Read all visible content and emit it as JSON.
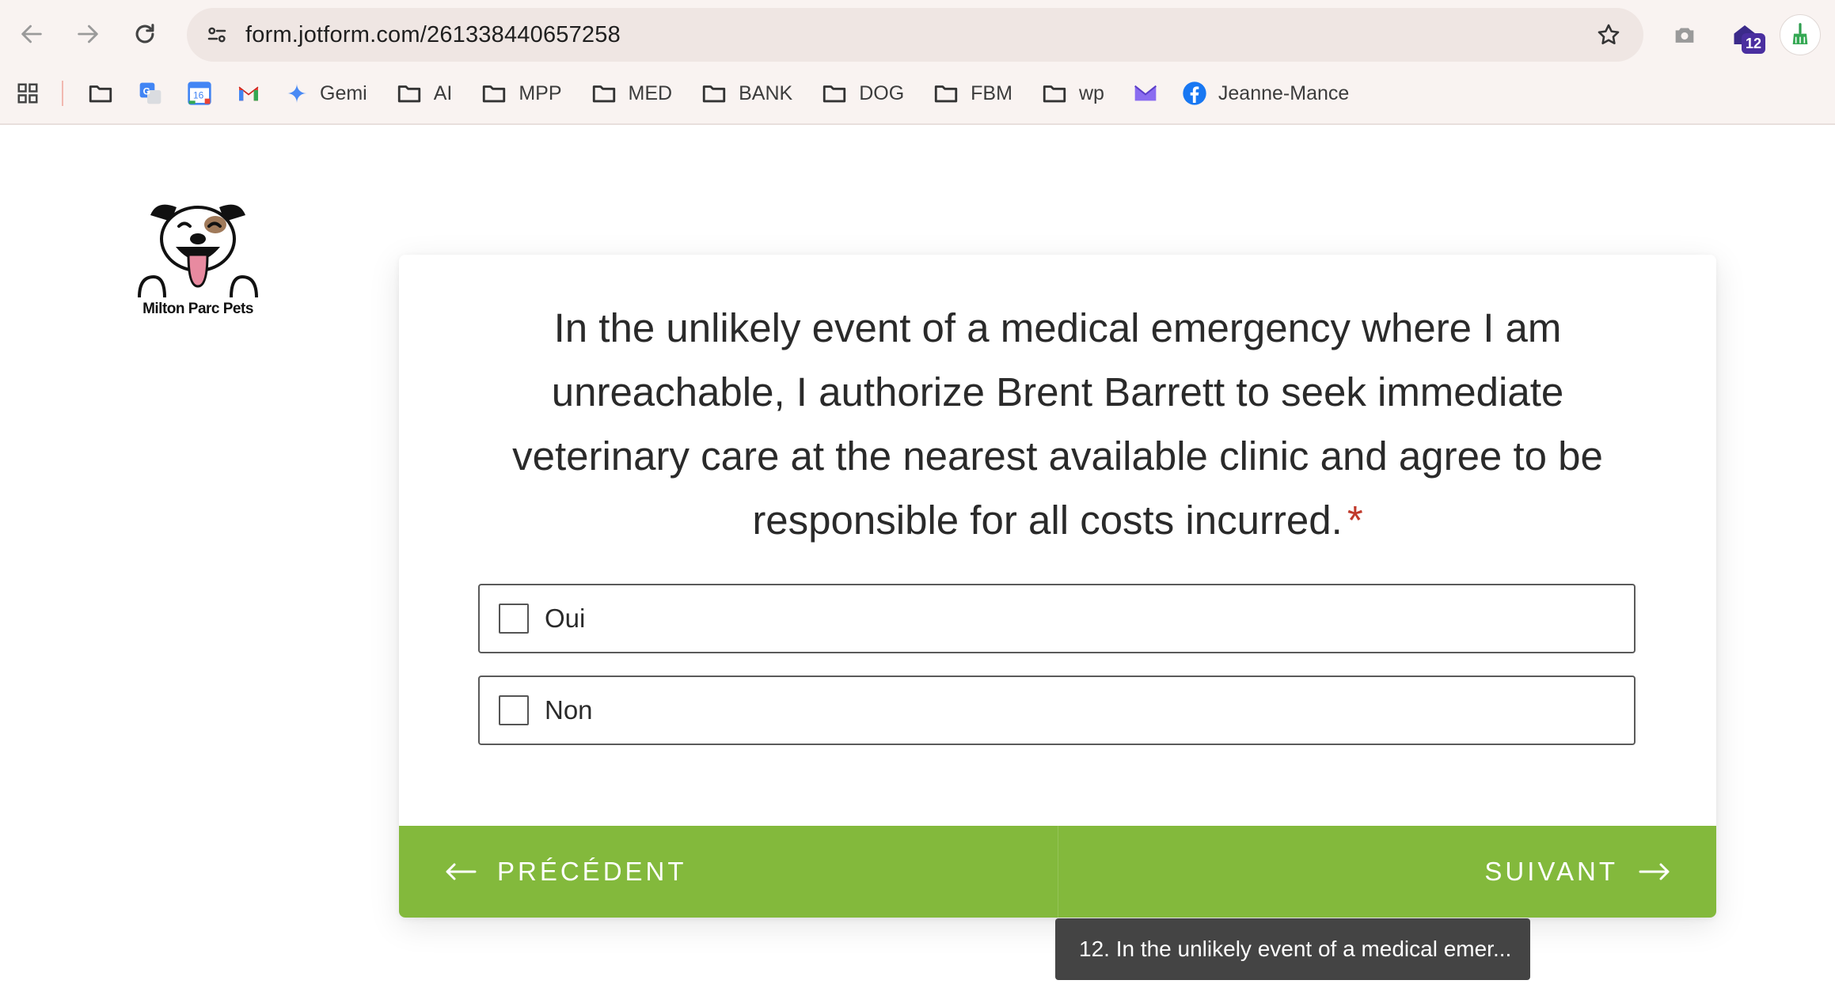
{
  "browser": {
    "url": "form.jotform.com/261338440657258",
    "extension_badge": "12",
    "bookmarks": [
      {
        "type": "apps",
        "label": ""
      },
      {
        "type": "folder",
        "label": ""
      },
      {
        "type": "translate",
        "label": ""
      },
      {
        "type": "calendar",
        "label": "",
        "calendar_day": "16"
      },
      {
        "type": "gmail",
        "label": ""
      },
      {
        "type": "gemini",
        "label": "Gemi"
      },
      {
        "type": "folder",
        "label": "AI"
      },
      {
        "type": "folder",
        "label": "MPP"
      },
      {
        "type": "folder",
        "label": "MED"
      },
      {
        "type": "folder",
        "label": "BANK"
      },
      {
        "type": "folder",
        "label": "DOG"
      },
      {
        "type": "folder",
        "label": "FBM"
      },
      {
        "type": "folder",
        "label": "wp"
      },
      {
        "type": "proton",
        "label": ""
      },
      {
        "type": "facebook",
        "label": "Jeanne-Mance"
      }
    ]
  },
  "logo": {
    "text": "Milton Parc Pets"
  },
  "question": {
    "text": "In the unlikely event of a medical emergency where I am unreachable, I authorize Brent Barrett to seek immediate veterinary care at the nearest available clinic and agree to be responsible for all costs incurred.",
    "required_mark": "*"
  },
  "options": [
    {
      "label": "Oui",
      "checked": false
    },
    {
      "label": "Non",
      "checked": false
    }
  ],
  "footer": {
    "prev_label": "PRÉCÉDENT",
    "next_label": "SUIVANT"
  },
  "tooltip": "12. In the unlikely event of a medical emer...",
  "colors": {
    "accent_green": "#83b93c",
    "required_red": "#c0392b",
    "tooltip_bg": "#444444"
  }
}
